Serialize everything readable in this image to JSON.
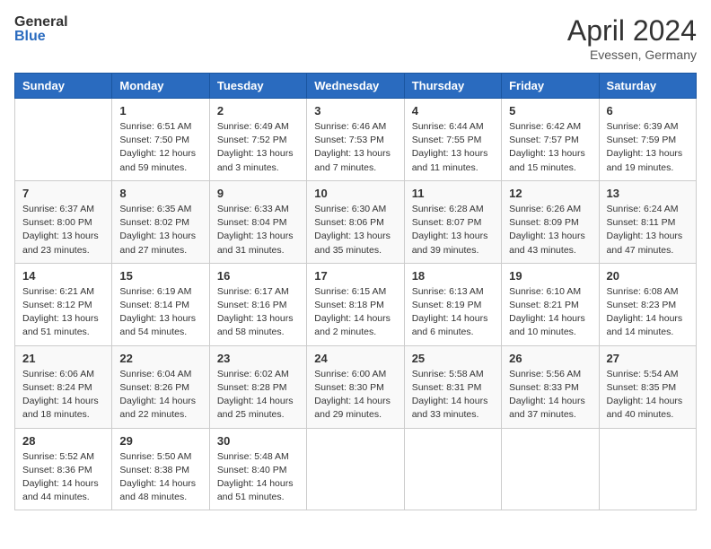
{
  "header": {
    "logo_general": "General",
    "logo_blue": "Blue",
    "month": "April 2024",
    "location": "Evessen, Germany"
  },
  "days_of_week": [
    "Sunday",
    "Monday",
    "Tuesday",
    "Wednesday",
    "Thursday",
    "Friday",
    "Saturday"
  ],
  "weeks": [
    [
      {
        "day": "",
        "sunrise": "",
        "sunset": "",
        "daylight": ""
      },
      {
        "day": "1",
        "sunrise": "Sunrise: 6:51 AM",
        "sunset": "Sunset: 7:50 PM",
        "daylight": "Daylight: 12 hours and 59 minutes."
      },
      {
        "day": "2",
        "sunrise": "Sunrise: 6:49 AM",
        "sunset": "Sunset: 7:52 PM",
        "daylight": "Daylight: 13 hours and 3 minutes."
      },
      {
        "day": "3",
        "sunrise": "Sunrise: 6:46 AM",
        "sunset": "Sunset: 7:53 PM",
        "daylight": "Daylight: 13 hours and 7 minutes."
      },
      {
        "day": "4",
        "sunrise": "Sunrise: 6:44 AM",
        "sunset": "Sunset: 7:55 PM",
        "daylight": "Daylight: 13 hours and 11 minutes."
      },
      {
        "day": "5",
        "sunrise": "Sunrise: 6:42 AM",
        "sunset": "Sunset: 7:57 PM",
        "daylight": "Daylight: 13 hours and 15 minutes."
      },
      {
        "day": "6",
        "sunrise": "Sunrise: 6:39 AM",
        "sunset": "Sunset: 7:59 PM",
        "daylight": "Daylight: 13 hours and 19 minutes."
      }
    ],
    [
      {
        "day": "7",
        "sunrise": "Sunrise: 6:37 AM",
        "sunset": "Sunset: 8:00 PM",
        "daylight": "Daylight: 13 hours and 23 minutes."
      },
      {
        "day": "8",
        "sunrise": "Sunrise: 6:35 AM",
        "sunset": "Sunset: 8:02 PM",
        "daylight": "Daylight: 13 hours and 27 minutes."
      },
      {
        "day": "9",
        "sunrise": "Sunrise: 6:33 AM",
        "sunset": "Sunset: 8:04 PM",
        "daylight": "Daylight: 13 hours and 31 minutes."
      },
      {
        "day": "10",
        "sunrise": "Sunrise: 6:30 AM",
        "sunset": "Sunset: 8:06 PM",
        "daylight": "Daylight: 13 hours and 35 minutes."
      },
      {
        "day": "11",
        "sunrise": "Sunrise: 6:28 AM",
        "sunset": "Sunset: 8:07 PM",
        "daylight": "Daylight: 13 hours and 39 minutes."
      },
      {
        "day": "12",
        "sunrise": "Sunrise: 6:26 AM",
        "sunset": "Sunset: 8:09 PM",
        "daylight": "Daylight: 13 hours and 43 minutes."
      },
      {
        "day": "13",
        "sunrise": "Sunrise: 6:24 AM",
        "sunset": "Sunset: 8:11 PM",
        "daylight": "Daylight: 13 hours and 47 minutes."
      }
    ],
    [
      {
        "day": "14",
        "sunrise": "Sunrise: 6:21 AM",
        "sunset": "Sunset: 8:12 PM",
        "daylight": "Daylight: 13 hours and 51 minutes."
      },
      {
        "day": "15",
        "sunrise": "Sunrise: 6:19 AM",
        "sunset": "Sunset: 8:14 PM",
        "daylight": "Daylight: 13 hours and 54 minutes."
      },
      {
        "day": "16",
        "sunrise": "Sunrise: 6:17 AM",
        "sunset": "Sunset: 8:16 PM",
        "daylight": "Daylight: 13 hours and 58 minutes."
      },
      {
        "day": "17",
        "sunrise": "Sunrise: 6:15 AM",
        "sunset": "Sunset: 8:18 PM",
        "daylight": "Daylight: 14 hours and 2 minutes."
      },
      {
        "day": "18",
        "sunrise": "Sunrise: 6:13 AM",
        "sunset": "Sunset: 8:19 PM",
        "daylight": "Daylight: 14 hours and 6 minutes."
      },
      {
        "day": "19",
        "sunrise": "Sunrise: 6:10 AM",
        "sunset": "Sunset: 8:21 PM",
        "daylight": "Daylight: 14 hours and 10 minutes."
      },
      {
        "day": "20",
        "sunrise": "Sunrise: 6:08 AM",
        "sunset": "Sunset: 8:23 PM",
        "daylight": "Daylight: 14 hours and 14 minutes."
      }
    ],
    [
      {
        "day": "21",
        "sunrise": "Sunrise: 6:06 AM",
        "sunset": "Sunset: 8:24 PM",
        "daylight": "Daylight: 14 hours and 18 minutes."
      },
      {
        "day": "22",
        "sunrise": "Sunrise: 6:04 AM",
        "sunset": "Sunset: 8:26 PM",
        "daylight": "Daylight: 14 hours and 22 minutes."
      },
      {
        "day": "23",
        "sunrise": "Sunrise: 6:02 AM",
        "sunset": "Sunset: 8:28 PM",
        "daylight": "Daylight: 14 hours and 25 minutes."
      },
      {
        "day": "24",
        "sunrise": "Sunrise: 6:00 AM",
        "sunset": "Sunset: 8:30 PM",
        "daylight": "Daylight: 14 hours and 29 minutes."
      },
      {
        "day": "25",
        "sunrise": "Sunrise: 5:58 AM",
        "sunset": "Sunset: 8:31 PM",
        "daylight": "Daylight: 14 hours and 33 minutes."
      },
      {
        "day": "26",
        "sunrise": "Sunrise: 5:56 AM",
        "sunset": "Sunset: 8:33 PM",
        "daylight": "Daylight: 14 hours and 37 minutes."
      },
      {
        "day": "27",
        "sunrise": "Sunrise: 5:54 AM",
        "sunset": "Sunset: 8:35 PM",
        "daylight": "Daylight: 14 hours and 40 minutes."
      }
    ],
    [
      {
        "day": "28",
        "sunrise": "Sunrise: 5:52 AM",
        "sunset": "Sunset: 8:36 PM",
        "daylight": "Daylight: 14 hours and 44 minutes."
      },
      {
        "day": "29",
        "sunrise": "Sunrise: 5:50 AM",
        "sunset": "Sunset: 8:38 PM",
        "daylight": "Daylight: 14 hours and 48 minutes."
      },
      {
        "day": "30",
        "sunrise": "Sunrise: 5:48 AM",
        "sunset": "Sunset: 8:40 PM",
        "daylight": "Daylight: 14 hours and 51 minutes."
      },
      {
        "day": "",
        "sunrise": "",
        "sunset": "",
        "daylight": ""
      },
      {
        "day": "",
        "sunrise": "",
        "sunset": "",
        "daylight": ""
      },
      {
        "day": "",
        "sunrise": "",
        "sunset": "",
        "daylight": ""
      },
      {
        "day": "",
        "sunrise": "",
        "sunset": "",
        "daylight": ""
      }
    ]
  ]
}
